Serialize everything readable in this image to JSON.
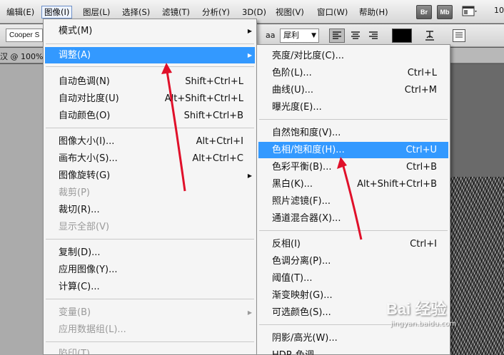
{
  "menubar": {
    "items": [
      {
        "label": "编辑(E)"
      },
      {
        "label": "图像(I)"
      },
      {
        "label": "图层(L)"
      },
      {
        "label": "选择(S)"
      },
      {
        "label": "滤镜(T)"
      },
      {
        "label": "分析(Y)"
      },
      {
        "label": "3D(D)"
      },
      {
        "label": "视图(V)"
      },
      {
        "label": "窗口(W)"
      },
      {
        "label": "帮助(H)"
      }
    ],
    "app_icons": [
      "Br",
      "Mb"
    ],
    "zoom_partial": "10"
  },
  "options": {
    "font_family": "Cooper S",
    "aa_icon": "aa",
    "aa_value": "犀利"
  },
  "document": {
    "tab_partial": "汉 @ 100%("
  },
  "menu_image": {
    "items": [
      {
        "label": "模式(M)",
        "submenu": true
      },
      {
        "label": "调整(A)",
        "submenu": true,
        "highlighted": true
      },
      {
        "label": "自动色调(N)",
        "shortcut": "Shift+Ctrl+L"
      },
      {
        "label": "自动对比度(U)",
        "shortcut": "Alt+Shift+Ctrl+L"
      },
      {
        "label": "自动颜色(O)",
        "shortcut": "Shift+Ctrl+B"
      },
      {
        "label": "图像大小(I)...",
        "shortcut": "Alt+Ctrl+I"
      },
      {
        "label": "画布大小(S)...",
        "shortcut": "Alt+Ctrl+C"
      },
      {
        "label": "图像旋转(G)",
        "submenu": true
      },
      {
        "label": "裁剪(P)",
        "disabled": true
      },
      {
        "label": "裁切(R)..."
      },
      {
        "label": "显示全部(V)",
        "disabled": true
      },
      {
        "label": "复制(D)..."
      },
      {
        "label": "应用图像(Y)..."
      },
      {
        "label": "计算(C)..."
      },
      {
        "label": "变量(B)",
        "submenu": true,
        "disabled": true
      },
      {
        "label": "应用数据组(L)...",
        "disabled": true
      },
      {
        "label": "陷印(T)...",
        "disabled": true
      }
    ]
  },
  "menu_adjust": {
    "items": [
      {
        "label": "亮度/对比度(C)..."
      },
      {
        "label": "色阶(L)...",
        "shortcut": "Ctrl+L"
      },
      {
        "label": "曲线(U)...",
        "shortcut": "Ctrl+M"
      },
      {
        "label": "曝光度(E)..."
      },
      {
        "label": "自然饱和度(V)..."
      },
      {
        "label": "色相/饱和度(H)...",
        "shortcut": "Ctrl+U",
        "highlighted": true
      },
      {
        "label": "色彩平衡(B)...",
        "shortcut": "Ctrl+B"
      },
      {
        "label": "黑白(K)...",
        "shortcut": "Alt+Shift+Ctrl+B"
      },
      {
        "label": "照片滤镜(F)..."
      },
      {
        "label": "通道混合器(X)..."
      },
      {
        "label": "反相(I)",
        "shortcut": "Ctrl+I"
      },
      {
        "label": "色调分离(P)..."
      },
      {
        "label": "阈值(T)..."
      },
      {
        "label": "渐变映射(G)..."
      },
      {
        "label": "可选颜色(S)..."
      },
      {
        "label": "阴影/高光(W)..."
      },
      {
        "label": "HDR 色调..."
      }
    ]
  },
  "watermark": {
    "logo": "Bai 经验",
    "url": "jingyan.baidu.com"
  },
  "colors": {
    "highlight": "#3399ff",
    "annotation_arrow": "#e0102a"
  }
}
